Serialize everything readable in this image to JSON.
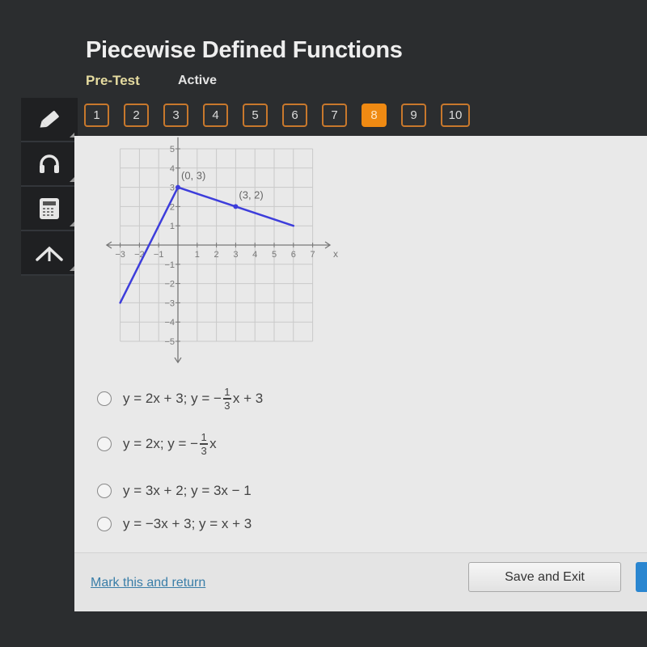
{
  "header": {
    "title": "Piecewise Defined Functions",
    "subtitle": "Pre-Test",
    "status": "Active"
  },
  "question_nav": {
    "items": [
      "1",
      "2",
      "3",
      "4",
      "5",
      "6",
      "7",
      "8",
      "9",
      "10"
    ],
    "current": "8",
    "active_color": "#ef8a13"
  },
  "tools": [
    {
      "name": "pencil-icon"
    },
    {
      "name": "headphones-icon"
    },
    {
      "name": "calculator-icon"
    },
    {
      "name": "collapse-icon"
    }
  ],
  "graph": {
    "x_ticks": [
      "-3",
      "-2",
      "-1",
      "1",
      "2",
      "3",
      "4",
      "5",
      "6",
      "7"
    ],
    "y_ticks": [
      "5",
      "4",
      "3",
      "2",
      "1",
      "-1",
      "-2",
      "-3",
      "-4",
      "-5"
    ],
    "x_axis_label": "x",
    "segments": [
      {
        "from": [
          -3,
          -3
        ],
        "to": [
          0,
          3
        ]
      },
      {
        "from": [
          0,
          3
        ],
        "to": [
          6,
          1
        ]
      }
    ],
    "labeled_points": [
      {
        "x": 0,
        "y": 3,
        "label": "(0, 3)"
      },
      {
        "x": 3,
        "y": 2,
        "label": "(3, 2)"
      }
    ],
    "line_color": "#3d3ddb"
  },
  "choices": [
    {
      "pre": "y = 2x + 3;  y = −",
      "num": "1",
      "den": "3",
      "post": "x + 3"
    },
    {
      "pre": "y = 2x;  y = −",
      "num": "1",
      "den": "3",
      "post": "x"
    },
    {
      "pre": "y = 3x + 2;  y = 3x − 1",
      "num": null,
      "den": null,
      "post": ""
    },
    {
      "pre": "y = −3x + 3;  y = x + 3",
      "num": null,
      "den": null,
      "post": ""
    }
  ],
  "footer": {
    "mark_link": "Mark this and return",
    "save_button": "Save and Exit"
  }
}
